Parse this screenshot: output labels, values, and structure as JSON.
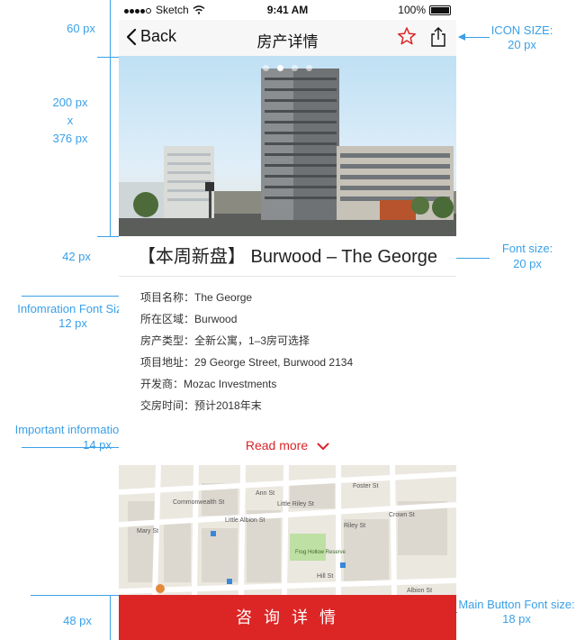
{
  "status_bar": {
    "carrier": "Sketch",
    "time": "9:41 AM",
    "battery": "100%"
  },
  "nav": {
    "back_label": "Back",
    "title": "房产详情",
    "icons": [
      "star-icon",
      "share-icon"
    ]
  },
  "carousel": {
    "pages": 4,
    "active_index": 1
  },
  "title": "【本周新盘】 Burwood – The George",
  "info_rows": [
    {
      "label": "项目名称：",
      "value": "The George"
    },
    {
      "label": "所在区域：",
      "value": "Burwood"
    },
    {
      "label": "房产类型：",
      "value": "全新公寓，1–3房可选择"
    },
    {
      "label": "项目地址：",
      "value": "29 George Street, Burwood 2134"
    },
    {
      "label": "开发商：",
      "value": "Mozac Investments"
    },
    {
      "label": "交房时间：",
      "value": "预计2018年末"
    }
  ],
  "read_more": "Read more",
  "map": {
    "streets": [
      "Ann St",
      "Little Albion St",
      "Albion St",
      "Frog Hollow Reserve",
      "Mary St",
      "Crown St",
      "Riley St",
      "Little Riley St",
      "Foster St",
      "Commonwealth St",
      "Hill St"
    ]
  },
  "cta_label": "咨 询 详 情",
  "annotations": {
    "status_nav_height": "60 px",
    "hero_size_1": "200 px",
    "hero_size_x": "x",
    "hero_size_2": "376 px",
    "title_height": "42 px",
    "info_font": "Infomration Font Size",
    "info_font_size": "12 px",
    "important_font": "Important information Font size:",
    "important_font_size": "14 px",
    "button_height": "48 px",
    "icon_size_label": "ICON SIZE:",
    "icon_size": "20 px",
    "title_font_label": "Font size:",
    "title_font_size": "20 px",
    "button_font_label": "Main Button Font size:",
    "button_font_size": "18 px"
  },
  "colors": {
    "accent": "#dc2626",
    "annotation": "#3aa0e8",
    "read_more": "#d9262a"
  }
}
